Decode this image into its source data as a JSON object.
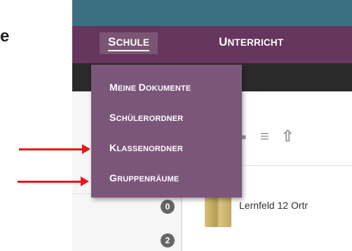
{
  "caption": "e",
  "nav": {
    "schule": {
      "first": "S",
      "rest": "CHULE"
    },
    "unterricht": {
      "first": "U",
      "rest": "NTERRICHT"
    }
  },
  "dropdown": {
    "items": [
      {
        "first": "M",
        "rest": "EINE ",
        "first2": "D",
        "rest2": "OKUMENTE"
      },
      {
        "first": "S",
        "rest": "CHÜLERORDNER",
        "first2": "",
        "rest2": ""
      },
      {
        "first": "K",
        "rest": "LASSENORDNER",
        "first2": "",
        "rest2": ""
      },
      {
        "first": "G",
        "rest": "RUPPENRÄUME",
        "first2": "",
        "rest2": ""
      }
    ]
  },
  "badges": [
    "0",
    "2"
  ],
  "folder": {
    "label": "Lernfeld 12 Ortr"
  },
  "colors": {
    "topbar": "#3b6f82",
    "navbar": "#66365f",
    "dropdown": "#7c567a",
    "arrow": "#e8171b"
  }
}
